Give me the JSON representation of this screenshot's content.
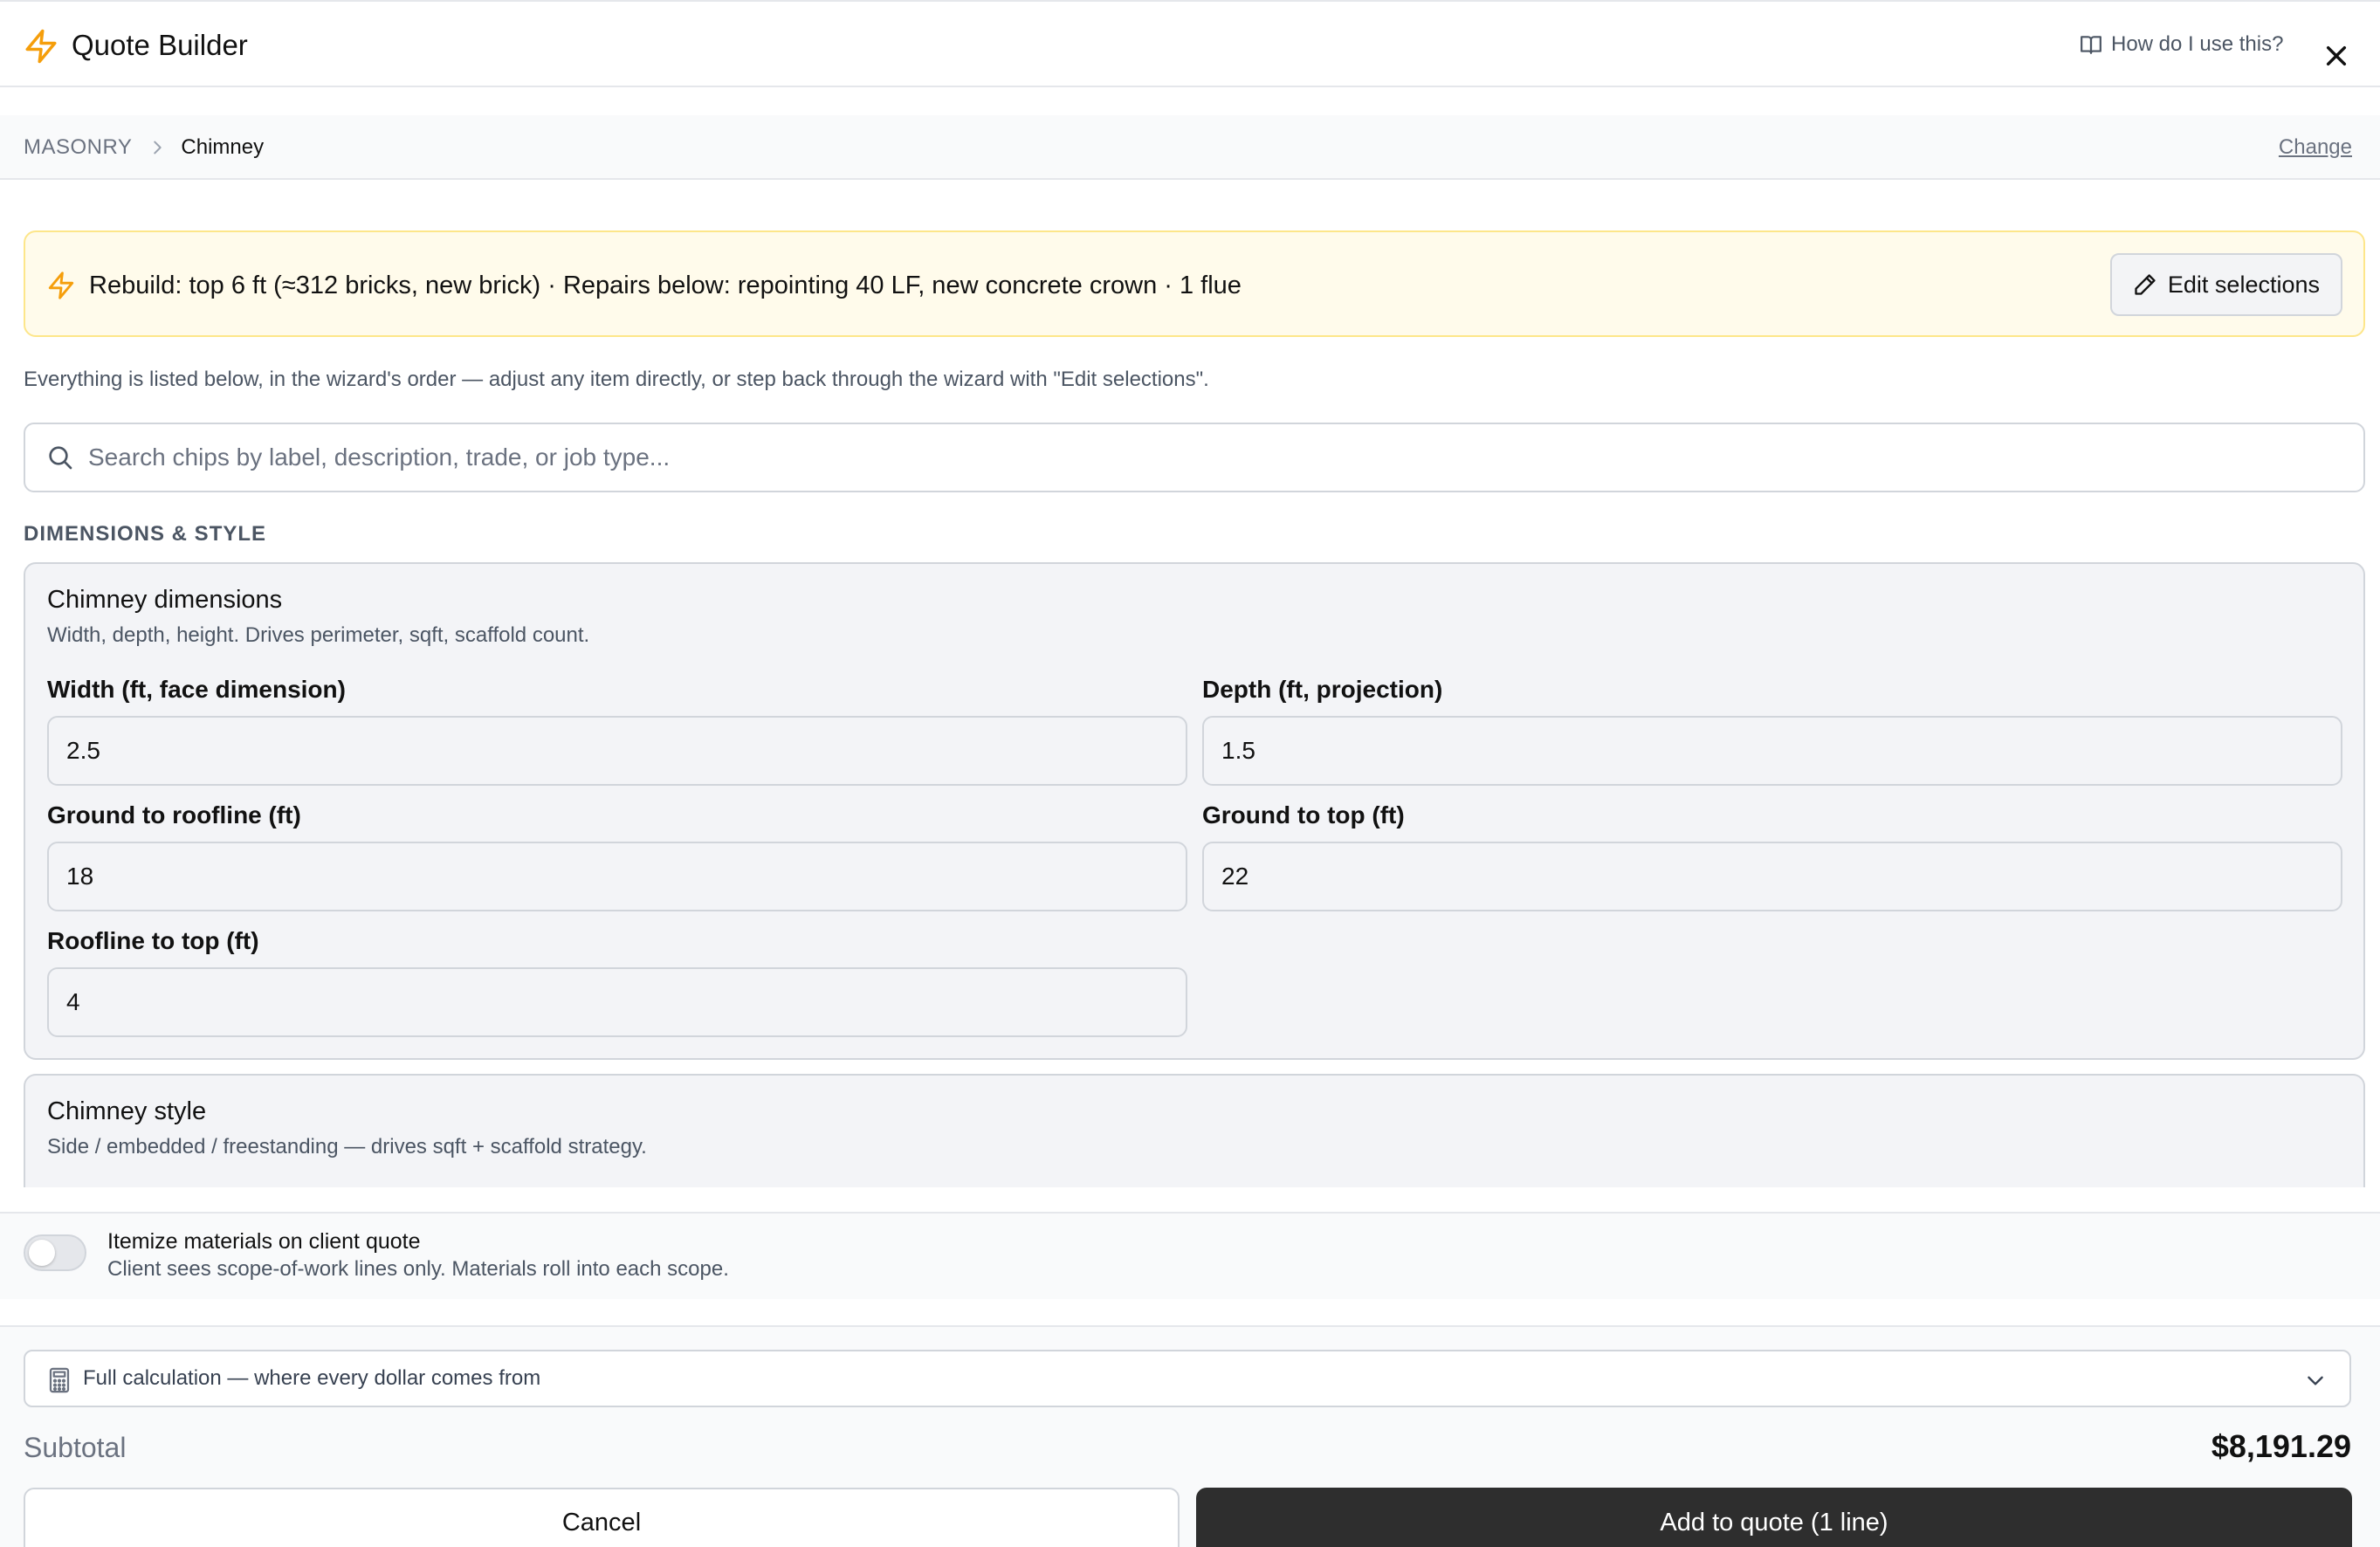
{
  "header": {
    "title": "Quote Builder",
    "help_label": "How do I use this?"
  },
  "breadcrumb": {
    "trade": "MASONRY",
    "current": "Chimney",
    "change_label": "Change"
  },
  "summary": {
    "text": "Rebuild: top 6 ft (≈312 bricks, new brick) · Repairs below: repointing 40 LF, new concrete crown · 1 flue",
    "edit_label": "Edit selections"
  },
  "hint": "Everything is listed below, in the wizard's order — adjust any item directly, or step back through the wizard with \"Edit selections\".",
  "search": {
    "placeholder": "Search chips by label, description, trade, or job type...",
    "value": ""
  },
  "section_label": "DIMENSIONS & STYLE",
  "dimensions": {
    "title": "Chimney dimensions",
    "description": "Width, depth, height. Drives perimeter, sqft, scaffold count.",
    "fields": [
      {
        "label": "Width (ft, face dimension)",
        "value": "2.5"
      },
      {
        "label": "Depth (ft, projection)",
        "value": "1.5"
      },
      {
        "label": "Ground to roofline (ft)",
        "value": "18"
      },
      {
        "label": "Ground to top (ft)",
        "value": "22"
      },
      {
        "label": "Roofline to top (ft)",
        "value": "4"
      }
    ]
  },
  "style": {
    "title": "Chimney style",
    "description": "Side / embedded / freestanding — drives sqft + scaffold strategy."
  },
  "itemize": {
    "title": "Itemize materials on client quote",
    "description": "Client sees scope-of-work lines only. Materials roll into each scope.",
    "enabled": false
  },
  "footer": {
    "calc_label": "Full calculation — where every dollar comes from",
    "subtotal_label": "Subtotal",
    "subtotal_value": "$8,191.29",
    "cancel_label": "Cancel",
    "add_label": "Add to quote (1 line)"
  },
  "icons": {
    "app": "lightning-bolt-icon",
    "help": "book-open-icon",
    "close": "close-icon",
    "search": "search-icon",
    "edit": "pencil-icon",
    "calc": "calculator-icon",
    "chevron": "chevron-down-icon"
  },
  "colors": {
    "accent": "#f59e0b",
    "banner_bg": "#fffbeb",
    "banner_border": "#fde68a",
    "primary_button": "#2e2e2e"
  }
}
